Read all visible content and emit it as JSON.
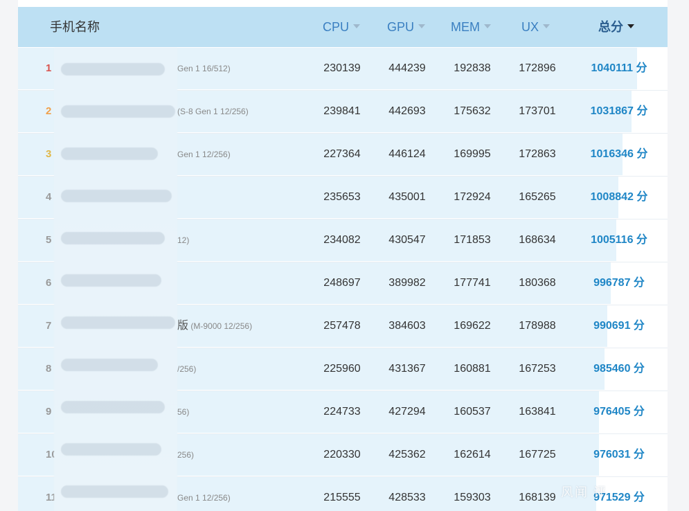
{
  "header": {
    "name": "手机名称",
    "cpu": "CPU",
    "gpu": "GPU",
    "mem": "MEM",
    "ux": "UX",
    "total": "总分"
  },
  "rows": [
    {
      "rank": "1",
      "model_suffix": "Gen 1 16/512)",
      "model_big": "",
      "cpu": "230139",
      "gpu": "444239",
      "mem": "192838",
      "ux": "172896",
      "score": "1040111 分",
      "fill_ratio": 0.953
    },
    {
      "rank": "2",
      "model_suffix": "(S-8 Gen 1 12/256)",
      "model_big": "",
      "cpu": "239841",
      "gpu": "442693",
      "mem": "175632",
      "ux": "173701",
      "score": "1031867 分",
      "fill_ratio": 0.945
    },
    {
      "rank": "3",
      "model_suffix": "Gen 1 12/256)",
      "model_big": "",
      "cpu": "227364",
      "gpu": "446124",
      "mem": "169995",
      "ux": "172863",
      "score": "1016346 分",
      "fill_ratio": 0.931
    },
    {
      "rank": "4",
      "model_suffix": "",
      "model_big": "",
      "cpu": "235653",
      "gpu": "435001",
      "mem": "172924",
      "ux": "165265",
      "score": "1008842 分",
      "fill_ratio": 0.924
    },
    {
      "rank": "5",
      "model_suffix": "12)",
      "model_big": "",
      "cpu": "234082",
      "gpu": "430547",
      "mem": "171853",
      "ux": "168634",
      "score": "1005116 分",
      "fill_ratio": 0.921
    },
    {
      "rank": "6",
      "model_suffix": "",
      "model_big": "",
      "cpu": "248697",
      "gpu": "389982",
      "mem": "177741",
      "ux": "180368",
      "score": "996787 分",
      "fill_ratio": 0.913
    },
    {
      "rank": "7",
      "model_suffix": "(M-9000 12/256)",
      "model_big": "版",
      "cpu": "257478",
      "gpu": "384603",
      "mem": "169622",
      "ux": "178988",
      "score": "990691 分",
      "fill_ratio": 0.907
    },
    {
      "rank": "8",
      "model_suffix": "/256)",
      "model_big": "",
      "cpu": "225960",
      "gpu": "431367",
      "mem": "160881",
      "ux": "167253",
      "score": "985460 分",
      "fill_ratio": 0.903
    },
    {
      "rank": "9",
      "model_suffix": "56)",
      "model_big": "",
      "cpu": "224733",
      "gpu": "427294",
      "mem": "160537",
      "ux": "163841",
      "score": "976405 分",
      "fill_ratio": 0.894
    },
    {
      "rank": "10",
      "model_suffix": "256)",
      "model_big": "",
      "cpu": "220330",
      "gpu": "425362",
      "mem": "162614",
      "ux": "167725",
      "score": "976031 分",
      "fill_ratio": 0.894
    },
    {
      "rank": "11",
      "model_suffix": "Gen 1 12/256)",
      "model_big": "",
      "cpu": "215555",
      "gpu": "428533",
      "mem": "159303",
      "ux": "168139",
      "score": "971529 分",
      "fill_ratio": 0.89
    }
  ],
  "watermark": "风闻 评",
  "colors": {
    "header_bg": "#bde0f3",
    "row_fill": "#e5f3fb",
    "score_blue": "#1f86c6",
    "rank1": "#d9534f",
    "rank2": "#f0a04b",
    "rank3": "#e0b84a"
  }
}
